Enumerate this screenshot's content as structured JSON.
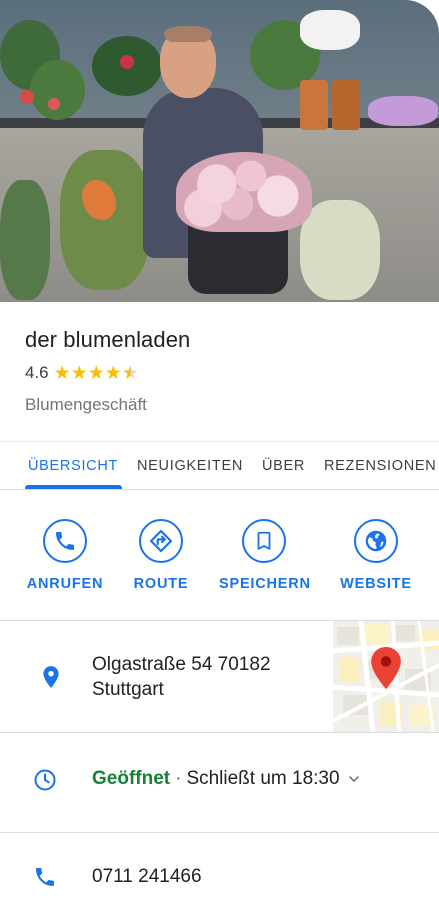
{
  "business": {
    "name": "der blumenladen",
    "rating": "4.6",
    "stars": [
      1,
      1,
      1,
      1,
      0.5
    ],
    "category": "Blumengeschäft"
  },
  "tabs": [
    {
      "label": "ÜBERSICHT",
      "active": true
    },
    {
      "label": "NEUIGKEITEN",
      "active": false
    },
    {
      "label": "ÜBER",
      "active": false
    },
    {
      "label": "REZENSIONEN",
      "active": false
    }
  ],
  "actions": [
    {
      "label": "ANRUFEN",
      "icon": "phone-icon"
    },
    {
      "label": "ROUTE",
      "icon": "directions-icon"
    },
    {
      "label": "SPEICHERN",
      "icon": "bookmark-icon"
    },
    {
      "label": "WEBSITE",
      "icon": "globe-icon"
    }
  ],
  "address": {
    "line1": "Olgastraße 54 70182",
    "line2": "Stuttgart",
    "icon": "location-pin-icon"
  },
  "hours": {
    "status": "Geöffnet",
    "separator": "·",
    "closing": "Schließt um 18:30",
    "icon": "clock-icon"
  },
  "phone": {
    "number": "0711 241466",
    "icon": "phone-icon"
  },
  "colors": {
    "accent": "#1a73e8",
    "open": "#188038",
    "star": "#fbbc04",
    "map_pin": "#ea4335"
  }
}
